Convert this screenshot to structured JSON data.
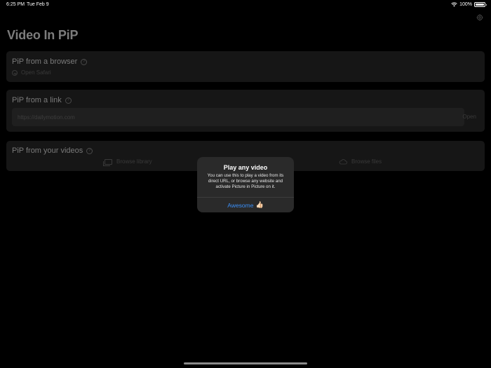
{
  "status_bar": {
    "time": "6:25 PM",
    "date": "Tue Feb 9",
    "battery": "100%",
    "icons": [
      "wifi-icon",
      "battery-icon"
    ]
  },
  "app": {
    "title": "Video In PiP",
    "settings_icon": "gear-icon"
  },
  "browser_section": {
    "title": "PiP from a browser",
    "help_icon": "question-mark-circle-icon",
    "open_safari_label": "Open Safari",
    "safari_icon": "compass-icon"
  },
  "link_section": {
    "title": "PiP from a link",
    "help_icon": "question-mark-circle-icon",
    "url_input": {
      "value": "",
      "placeholder": "https://dailymotion.com"
    },
    "open_label": "Open"
  },
  "videos_section": {
    "title": "PiP from your videos",
    "help_icon": "question-mark-circle-icon",
    "browse_library_label": "Browse library",
    "library_icon": "photo-stack-icon",
    "browse_files_label": "Browse files",
    "files_icon": "cloud-folder-icon"
  },
  "alert": {
    "title": "Play any video",
    "message": "You can use this to play a video from its direct URL, or browse any website and activate Picture in Picture on it.",
    "button_label": "Awesome",
    "button_emoji": "👍🏻"
  },
  "colors": {
    "background": "#000000",
    "card": "#161616",
    "alert_bg": "#2a2a2a",
    "accent": "#3a8ef6"
  }
}
